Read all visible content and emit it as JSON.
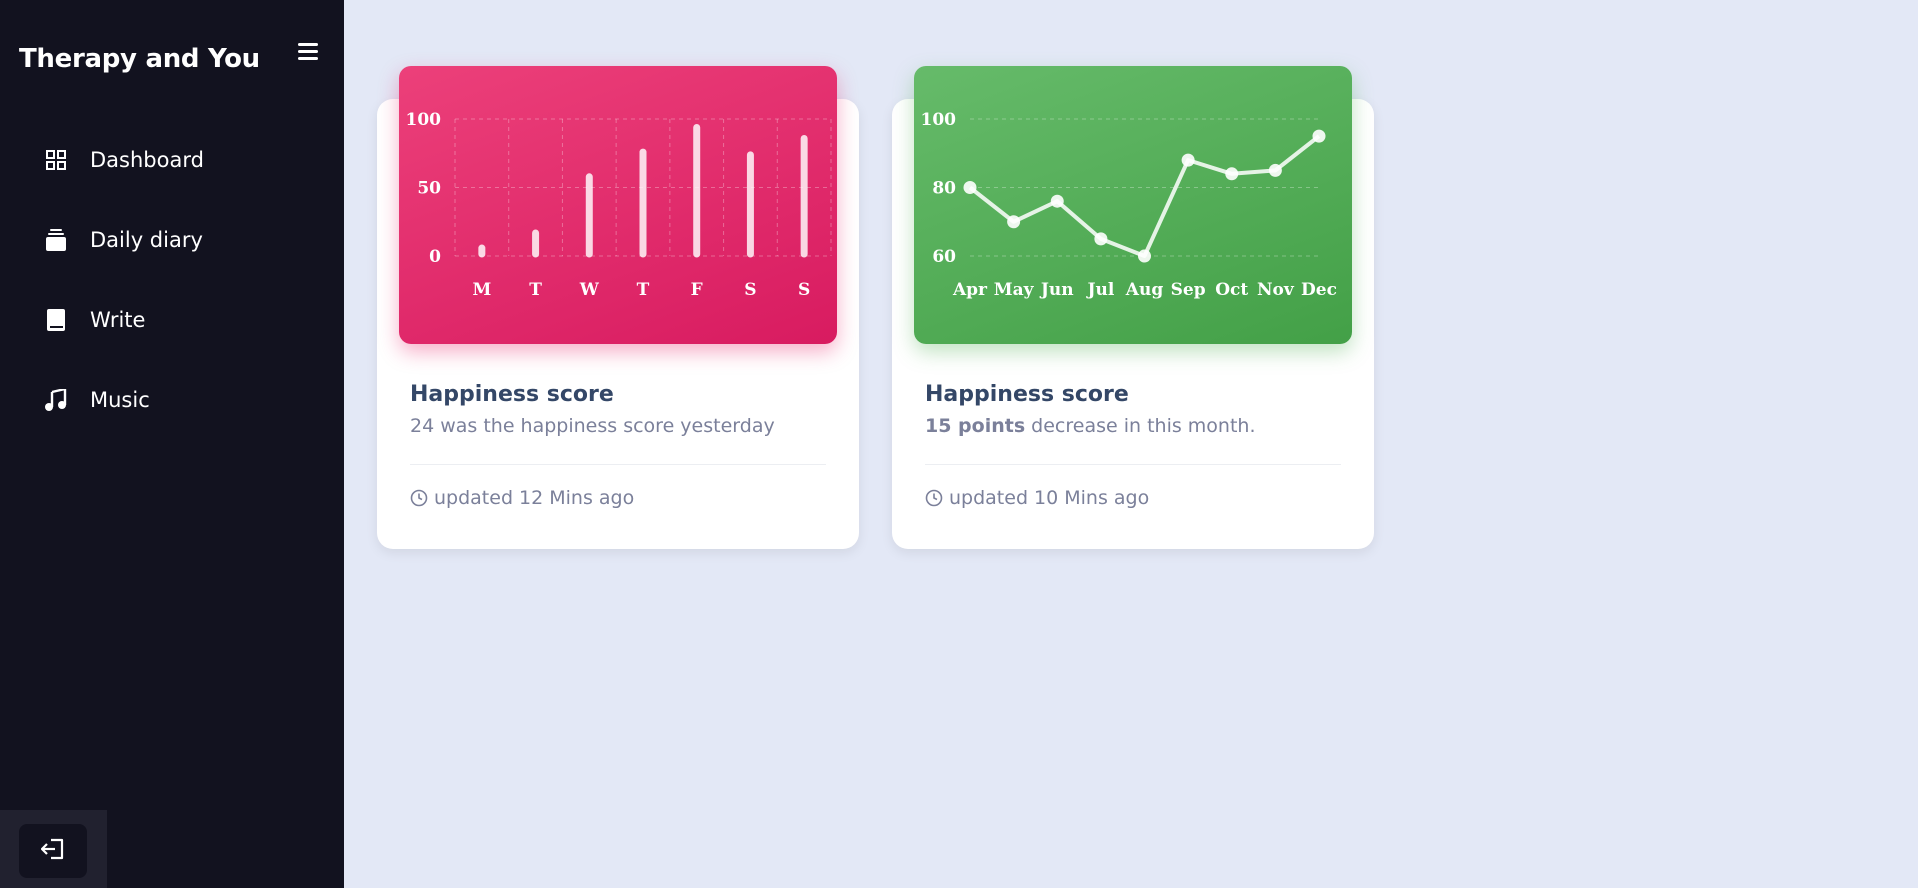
{
  "app": {
    "title": "Therapy and You"
  },
  "sidebar": {
    "items": [
      {
        "label": "Dashboard",
        "icon": "dashboard-icon"
      },
      {
        "label": "Daily diary",
        "icon": "diary-icon"
      },
      {
        "label": "Write",
        "icon": "book-icon"
      },
      {
        "label": "Music",
        "icon": "music-icon"
      }
    ],
    "logout_icon": "logout-icon"
  },
  "cards": [
    {
      "title": "Happiness score",
      "subtitle": "24 was the happiness score yesterday",
      "updated": "updated 12 Mins ago",
      "color": "#e91e63"
    },
    {
      "title": "Happiness score",
      "subtitle_bold": "15 points",
      "subtitle_rest": " decrease in this month.",
      "updated": "updated 10 Mins ago",
      "color": "#4caf50"
    }
  ],
  "chart_data": [
    {
      "type": "bar",
      "categories": [
        "M",
        "T",
        "W",
        "T",
        "F",
        "S",
        "S"
      ],
      "values": [
        8,
        19,
        60,
        78,
        96,
        76,
        88
      ],
      "yticks": [
        0,
        50,
        100
      ],
      "ylim": [
        0,
        100
      ],
      "grid": true
    },
    {
      "type": "line",
      "categories": [
        "Apr",
        "May",
        "Jun",
        "Jul",
        "Aug",
        "Sep",
        "Oct",
        "Nov",
        "Dec"
      ],
      "values": [
        80,
        70,
        76,
        65,
        60,
        88,
        84,
        85,
        95
      ],
      "yticks": [
        60,
        80,
        100
      ],
      "ylim": [
        60,
        100
      ],
      "grid": true
    }
  ]
}
